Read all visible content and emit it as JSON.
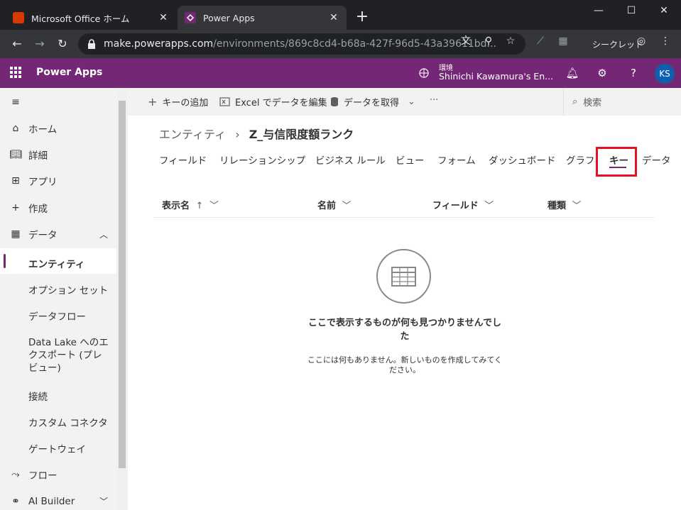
{
  "browser": {
    "tabs": [
      {
        "title": "Microsoft Office ホーム",
        "favicon": "office-icon",
        "color": "#d83b01"
      },
      {
        "title": "Power Apps",
        "favicon": "powerapps-icon",
        "color": "#742774"
      }
    ],
    "url_host": "make.powerapps.com",
    "url_path": "/environments/869c8cd4-b68a-427f-96d5-43a39611bd...",
    "incognito_label": "シークレット"
  },
  "app": {
    "name": "Power Apps",
    "env_label": "環境",
    "env_name": "Shinichi Kawamura's En...",
    "avatar_initials": "KS",
    "header_color": "#742774"
  },
  "sidebar": {
    "items": [
      {
        "label": "ホーム",
        "icon": "home-icon"
      },
      {
        "label": "詳細",
        "icon": "book-icon"
      },
      {
        "label": "アプリ",
        "icon": "apps-icon"
      },
      {
        "label": "作成",
        "icon": "plus-icon"
      },
      {
        "label": "データ",
        "icon": "table-icon"
      }
    ],
    "data_sub": [
      "エンティティ",
      "オプション セット",
      "データフロー",
      "Data Lake へのエクスポート (プレビュー)",
      "接続",
      "カスタム コネクタ",
      "ゲートウェイ"
    ],
    "bottom": [
      {
        "label": "フロー",
        "icon": "flow-icon"
      },
      {
        "label": "AI Builder",
        "icon": "ai-builder-icon"
      }
    ]
  },
  "commands": {
    "add_key": "キーの追加",
    "edit_excel": "Excel でデータを編集",
    "get_data": "データを取得",
    "more": "···",
    "search_placeholder": "検索"
  },
  "breadcrumb": {
    "parent": "エンティティ",
    "separator": "›",
    "current": "Z_与信限度額ランク"
  },
  "entity_tabs": [
    "フィールド",
    "リレーションシップ",
    "ビジネス ルール",
    "ビュー",
    "フォーム",
    "ダッシュボード",
    "グラフ",
    "キー",
    "データ"
  ],
  "selected_tab": "キー",
  "columns": [
    {
      "label": "表示名",
      "sort": "↑"
    },
    {
      "label": "名前",
      "sort": ""
    },
    {
      "label": "フィールド",
      "sort": ""
    },
    {
      "label": "種類",
      "sort": ""
    }
  ],
  "empty_state": {
    "title": "ここで表示するものが何も見つかりませんでした",
    "message": "ここには何もありません。新しいものを作成してみてください。"
  }
}
